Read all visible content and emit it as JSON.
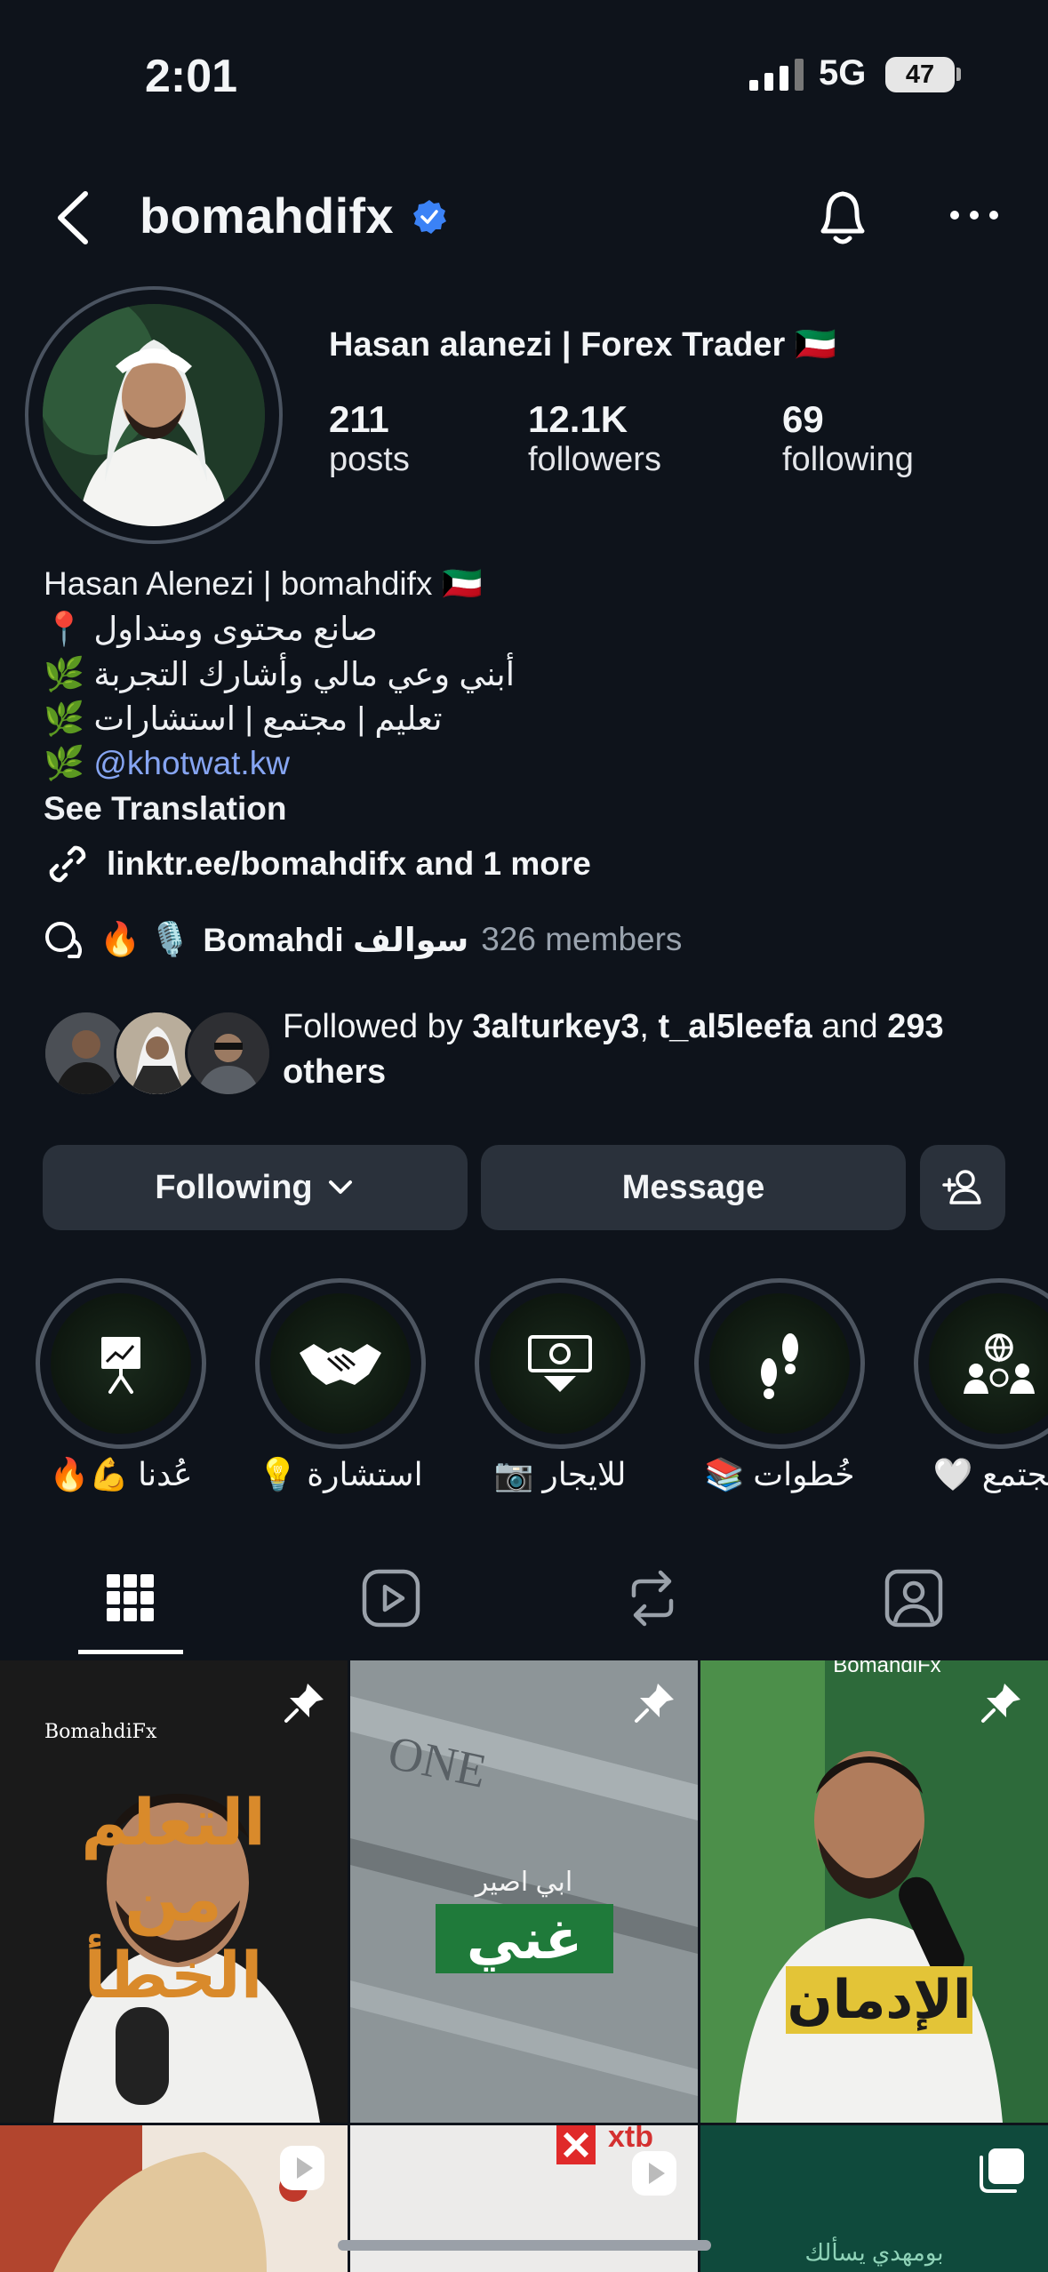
{
  "status_bar": {
    "time": "2:01",
    "network": "5G",
    "battery": "47"
  },
  "header": {
    "username": "bomahdifx"
  },
  "profile": {
    "display_name": "Hasan alanezi | Forex Trader 🇰🇼",
    "stats": [
      {
        "value": "211",
        "label": "posts"
      },
      {
        "value": "12.1K",
        "label": "followers"
      },
      {
        "value": "69",
        "label": "following"
      }
    ]
  },
  "bio": {
    "lines": [
      "Hasan Alenezi | bomahdifx 🇰🇼",
      "📍 صانع محتوى ومتداول",
      "🌿 أبني وعي مالي وأشارك التجربة",
      "🌿 تعليم | مجتمع | استشارات"
    ],
    "mention_prefix": "🌿",
    "mention": "@khotwat.kw",
    "see_translation": "See Translation",
    "link": "linktr.ee/bomahdifx and 1 more"
  },
  "channel": {
    "emoji": "🔥 🎙️",
    "name": "Bomahdi سوالف",
    "members": "326 members"
  },
  "followed_by": {
    "prefix": "Followed by",
    "user1": "3alturkey3",
    "sep": ",",
    "user2": "t_al5leefa",
    "and": "and",
    "count": "293",
    "others": "others"
  },
  "actions": {
    "following": "Following",
    "message": "Message"
  },
  "highlights": [
    {
      "label": "عُدنا 💪🔥",
      "icon": "chart-board-icon"
    },
    {
      "label": "استشارة 💡",
      "icon": "handshake-icon"
    },
    {
      "label": "للايجار 📷",
      "icon": "banknote-icon"
    },
    {
      "label": "خُطوات 📚",
      "icon": "footprints-icon"
    },
    {
      "label": "مجتمع 🤍",
      "icon": "community-globe-icon"
    }
  ],
  "tabs": [
    "grid",
    "reels",
    "reposts",
    "tagged"
  ],
  "posts": [
    {
      "overlay": "التعلم من الخطأ",
      "small": "BomahdiFx",
      "pinned": true
    },
    {
      "overlay": "غني",
      "small": "ابي اصير",
      "pinned": true
    },
    {
      "overlay": "الإدمان",
      "small": "BomahdiFx",
      "pinned": true
    },
    {
      "overlay": "",
      "small": "",
      "pinned": false
    },
    {
      "overlay": "",
      "small": "xtb",
      "pinned": false
    },
    {
      "overlay": "",
      "small": "بومهدي يسألك",
      "pinned": false
    }
  ],
  "colors": {
    "background": "#0e131b",
    "button": "#2a313b",
    "verified": "#3b82f6",
    "link": "#86a5f2"
  }
}
